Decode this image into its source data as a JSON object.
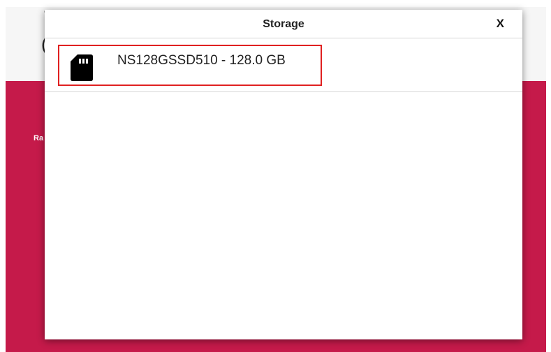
{
  "background": {
    "header_glyph_1": "'",
    "header_glyph_2": "(",
    "main_label": "Ra",
    "accent_color": "#c51a4a"
  },
  "dialog": {
    "title": "Storage",
    "close_label": "X",
    "items": [
      {
        "label": "NS128GSSD510 - 128.0 GB",
        "icon": "sd-card-icon",
        "selected": true
      }
    ]
  }
}
